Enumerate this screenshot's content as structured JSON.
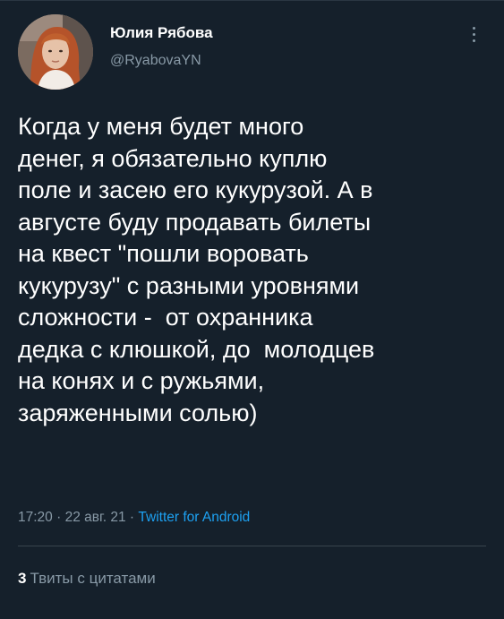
{
  "author": {
    "name": "Юлия Рябова",
    "handle": "@RyabovaYN"
  },
  "tweet": {
    "lines": [
      "Когда у меня будет много",
      "денег, я обязательно куплю",
      "поле и засею его кукурузой. А в",
      "августе буду продавать билеты",
      "на квест \"пошли воровать",
      "кукурузу\" с разными уровнями",
      "сложности -  от охранника",
      "дедка с клюшкой, до  молодцев",
      "на конях и с ружьями,",
      "заряженными солью)"
    ],
    "time": "17:20",
    "date": "22 авг. 21",
    "separator": " · ",
    "source": "Twitter for Android"
  },
  "stats": {
    "quote_count": "3",
    "quote_label": "Твиты с цитатами"
  },
  "icons": {
    "more": "more-vertical-icon"
  },
  "colors": {
    "background": "#15202b",
    "text": "#ffffff",
    "secondary": "#8899a6",
    "link": "#1da1f2",
    "divider": "#38444d"
  }
}
